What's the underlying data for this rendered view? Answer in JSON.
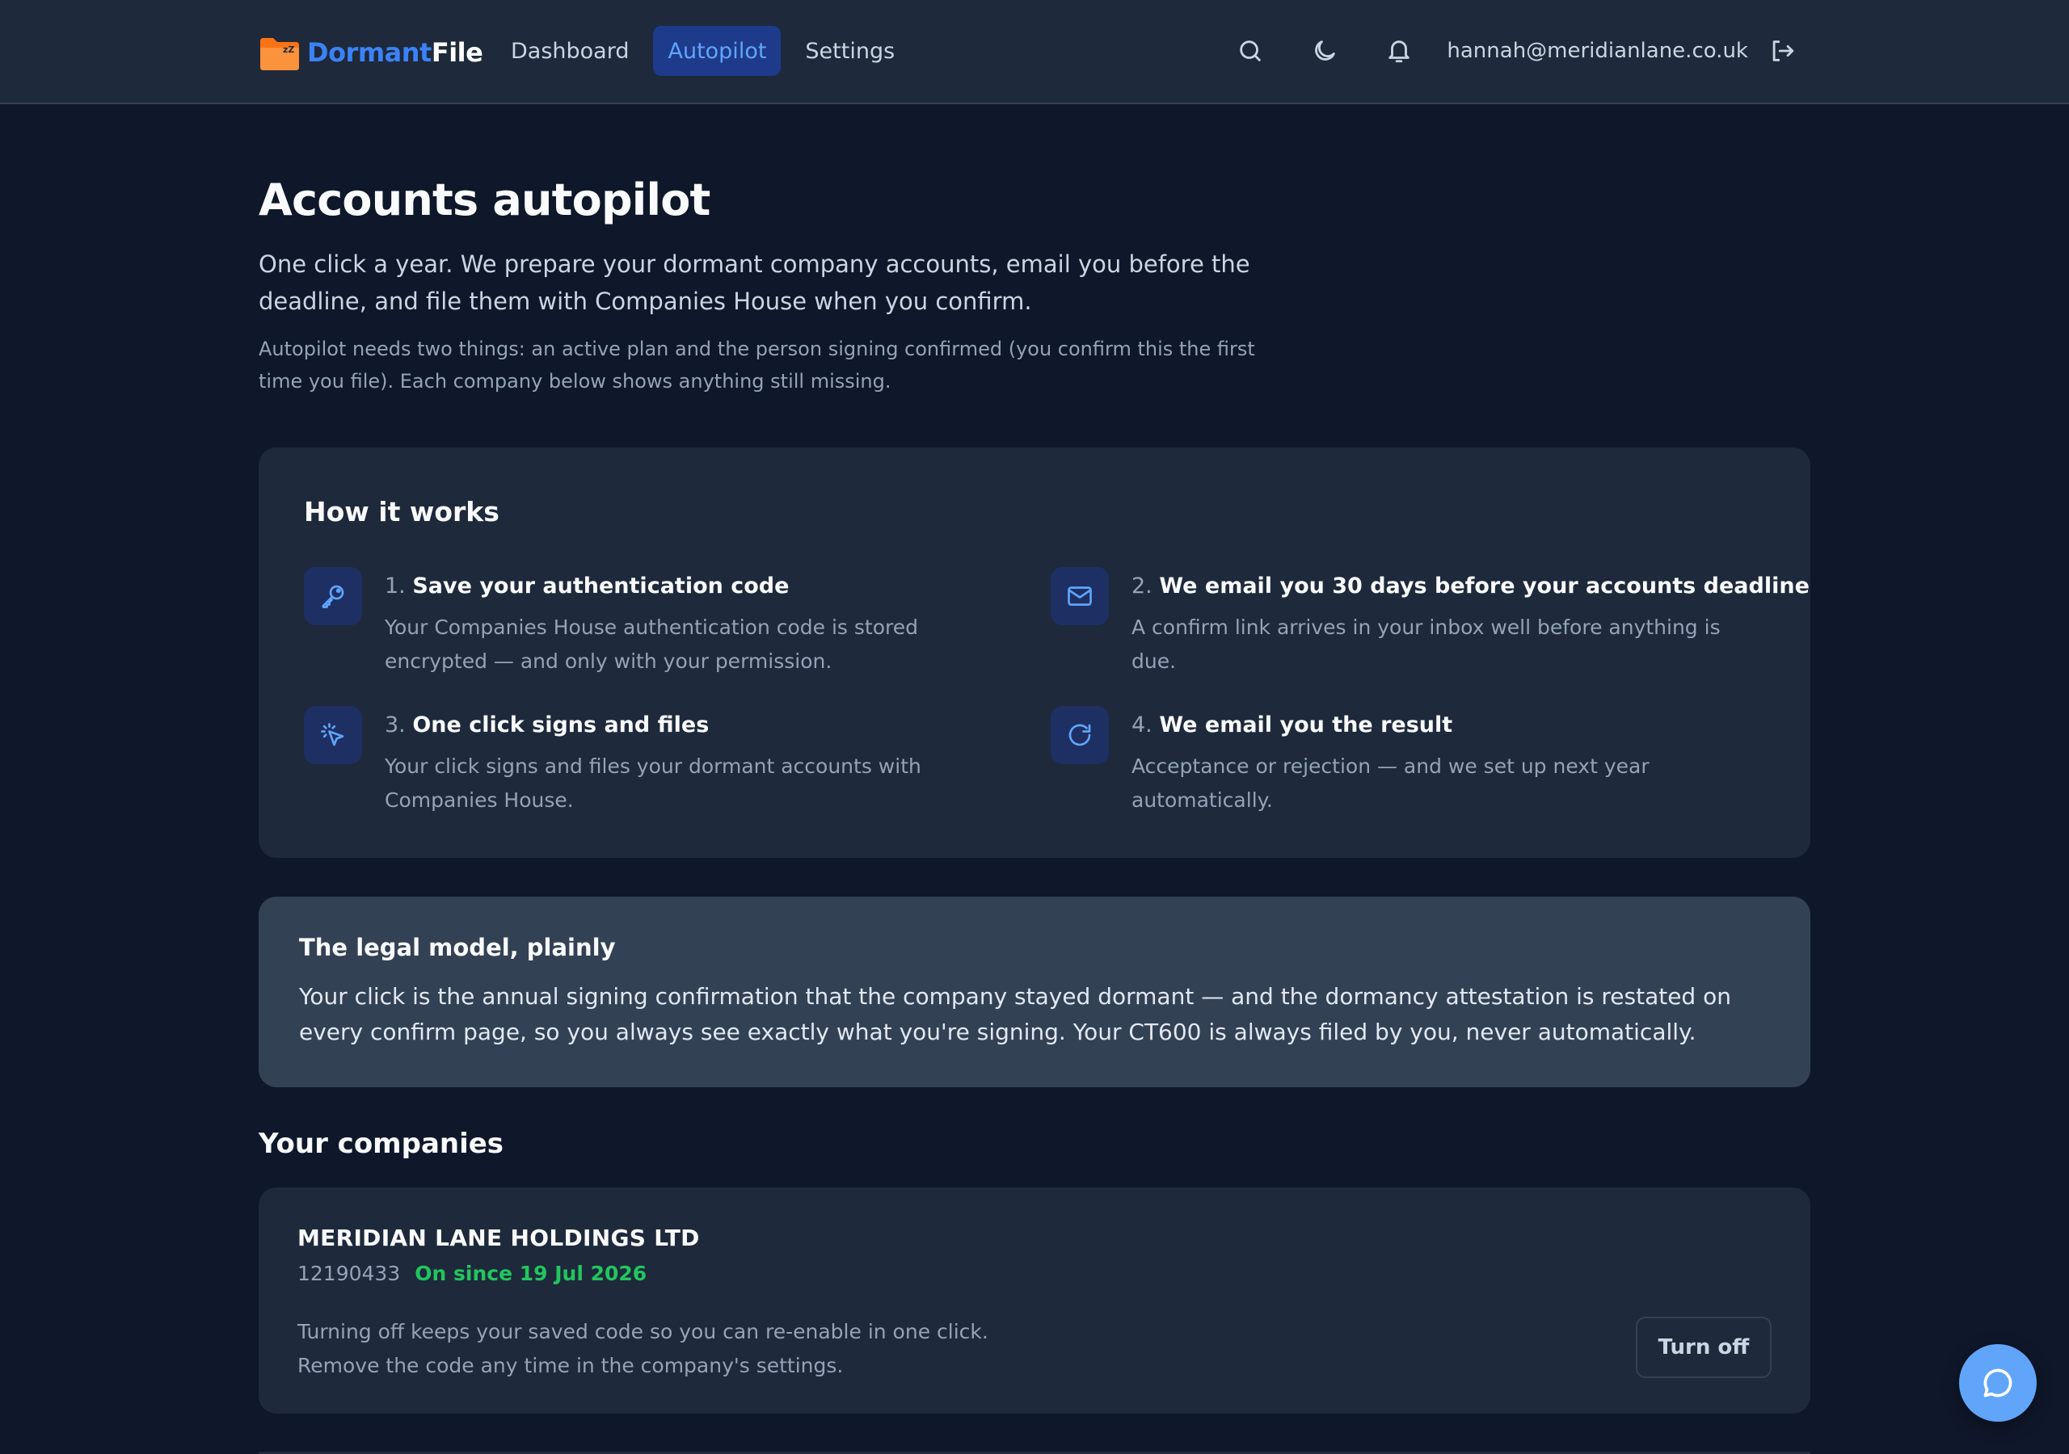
{
  "header": {
    "brand": {
      "part1": "Dormant",
      "part2": "File",
      "logo_icon": "folder-zzz-icon"
    },
    "nav": [
      {
        "label": "Dashboard",
        "active": false
      },
      {
        "label": "Autopilot",
        "active": true
      },
      {
        "label": "Settings",
        "active": false
      }
    ],
    "icons": [
      "search-icon",
      "moon-icon",
      "bell-icon",
      "logout-icon"
    ],
    "user_email": "hannah@meridianlane.co.uk"
  },
  "page": {
    "title": "Accounts autopilot",
    "lead": "One click a year. We prepare your dormant company accounts, email you before the deadline, and file them with Companies House when you confirm.",
    "note": "Autopilot needs two things: an active plan and the person signing confirmed (you confirm this the first time you file). Each company below shows anything still missing."
  },
  "how_it_works": {
    "title": "How it works",
    "steps": [
      {
        "number": "1.",
        "title": "Save your authentication code",
        "description": "Your Companies House authentication code is stored encrypted — and only with your permission.",
        "icon": "key-icon"
      },
      {
        "number": "2.",
        "title": "We email you 30 days before your accounts deadline",
        "description": "A confirm link arrives in your inbox well before anything is due.",
        "icon": "mail-icon"
      },
      {
        "number": "3.",
        "title": "One click signs and files",
        "description": "Your click signs and files your dormant accounts with Companies House.",
        "icon": "cursor-click-icon"
      },
      {
        "number": "4.",
        "title": "We email you the result",
        "description": "Acceptance or rejection — and we set up next year automatically.",
        "icon": "refresh-icon"
      }
    ]
  },
  "legal": {
    "title": "The legal model, plainly",
    "body": "Your click is the annual signing confirmation that the company stayed dormant — and the dormancy attestation is restated on every confirm page, so you always see exactly what you're signing. Your CT600 is always filed by you, never automatically."
  },
  "companies": {
    "title": "Your companies",
    "items": [
      {
        "name": "MERIDIAN LANE HOLDINGS LTD",
        "number": "12190433",
        "status": "On since 19 Jul 2026",
        "help": "Turning off keeps your saved code so you can re-enable in one click. Remove the code any time in the company's settings.",
        "action_label": "Turn off"
      }
    ]
  },
  "colors": {
    "background": "#0f172a",
    "surface": "#1e293b",
    "accent": "#60a5fa",
    "success": "#22c55e",
    "brand_orange": "#f97316"
  },
  "chat": {
    "icon": "chat-bubble-icon"
  }
}
